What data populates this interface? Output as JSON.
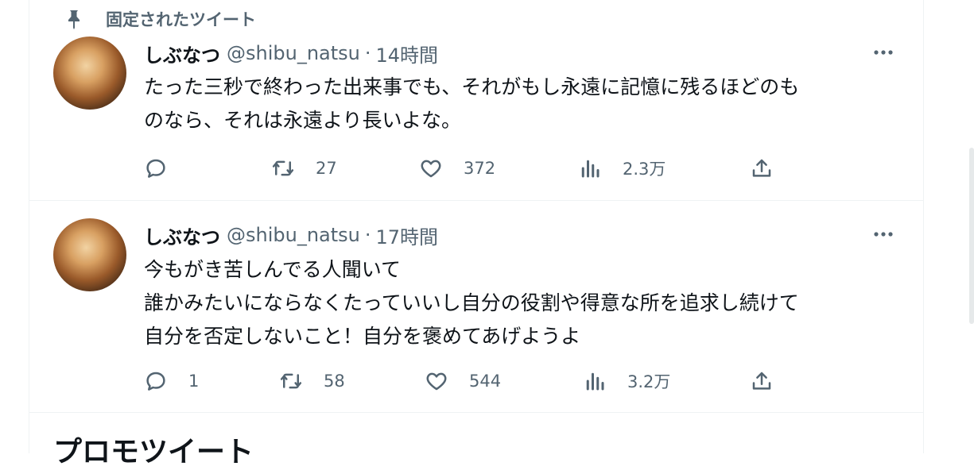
{
  "pinned_label": "固定されたツイート",
  "tweets": [
    {
      "name": "しぶなつ",
      "handle": "@shibu_natsu",
      "separator": "·",
      "time": "14時間",
      "lines": [
        "たった三秒で終わった出来事でも、それがもし永遠に記憶に残るほどのも",
        "のなら、それは永遠より長いよな。"
      ],
      "reply_count": "",
      "retweet_count": "27",
      "like_count": "372",
      "view_count": "2.3万"
    },
    {
      "name": "しぶなつ",
      "handle": "@shibu_natsu",
      "separator": "·",
      "time": "17時間",
      "lines": [
        "今もがき苦しんでる人聞いて",
        "誰かみたいにならなくたっていいし自分の役割や得意な所を追求し続けて",
        "自分を否定しないこと！自分を褒めてあげようよ"
      ],
      "reply_count": "1",
      "retweet_count": "58",
      "like_count": "544",
      "view_count": "3.2万"
    }
  ],
  "promo_heading": "プロモツイート",
  "colors": {
    "text_primary": "#0f1419",
    "text_secondary": "#536471",
    "border": "#eff3f4",
    "background": "#ffffff"
  },
  "icons": {
    "pin": "pin-icon",
    "more": "more-icon",
    "reply": "reply-icon",
    "retweet": "retweet-icon",
    "like": "like-icon",
    "views": "views-icon",
    "share": "share-icon"
  }
}
